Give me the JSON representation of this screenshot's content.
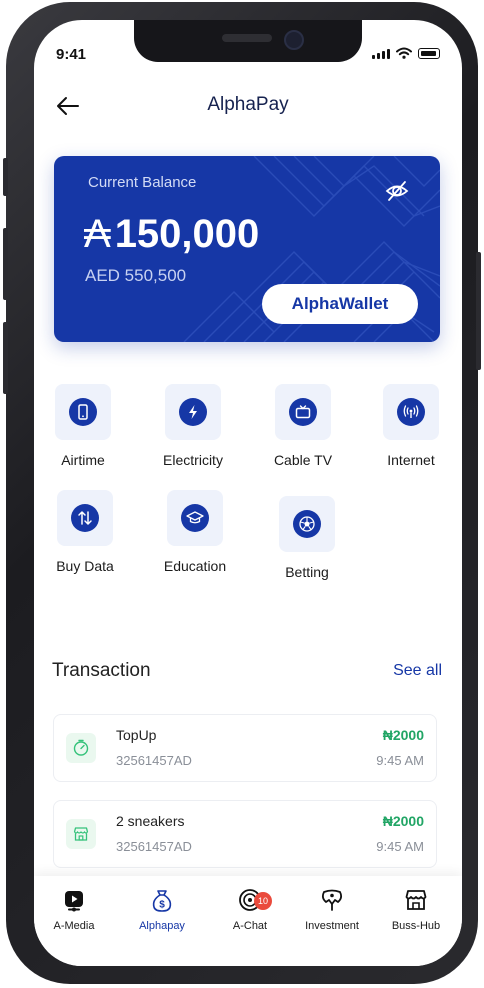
{
  "status_bar": {
    "time": "9:41"
  },
  "header": {
    "title": "AlphaPay"
  },
  "balance_card": {
    "label": "Current Balance",
    "currency_symbol": "₳",
    "amount": "150,000",
    "secondary_amount": "AED 550,500",
    "wallet_button": "AlphaWallet",
    "accent_color": "#1637a6"
  },
  "services": [
    {
      "label": "Airtime",
      "icon": "phone-icon"
    },
    {
      "label": "Electricity",
      "icon": "bolt-icon"
    },
    {
      "label": "Cable TV",
      "icon": "tv-icon"
    },
    {
      "label": "Internet",
      "icon": "antenna-icon"
    },
    {
      "label": "Buy Data",
      "icon": "up-down-arrows-icon"
    },
    {
      "label": "Education",
      "icon": "graduation-cap-icon"
    },
    {
      "label": "Betting",
      "icon": "soccer-ball-icon"
    }
  ],
  "transactions": {
    "title": "Transaction",
    "see_all": "See all",
    "items": [
      {
        "name": "TopUp",
        "ref": "32561457AD",
        "amount": "₦2000",
        "time": "9:45 AM",
        "icon": "timer-icon"
      },
      {
        "name": "2 sneakers",
        "ref": "32561457AD",
        "amount": "₦2000",
        "time": "9:45 AM",
        "icon": "shop-icon"
      }
    ],
    "amount_color": "#21a565"
  },
  "tabbar": {
    "items": [
      {
        "label": "A-Media",
        "icon": "media-play-icon",
        "active": false
      },
      {
        "label": "Alphapay",
        "icon": "money-bag-icon",
        "active": true
      },
      {
        "label": "A-Chat",
        "icon": "chat-icon",
        "active": false,
        "badge": "10"
      },
      {
        "label": "Investment",
        "icon": "investment-icon",
        "active": false
      },
      {
        "label": "Buss-Hub",
        "icon": "store-icon",
        "active": false
      }
    ]
  }
}
